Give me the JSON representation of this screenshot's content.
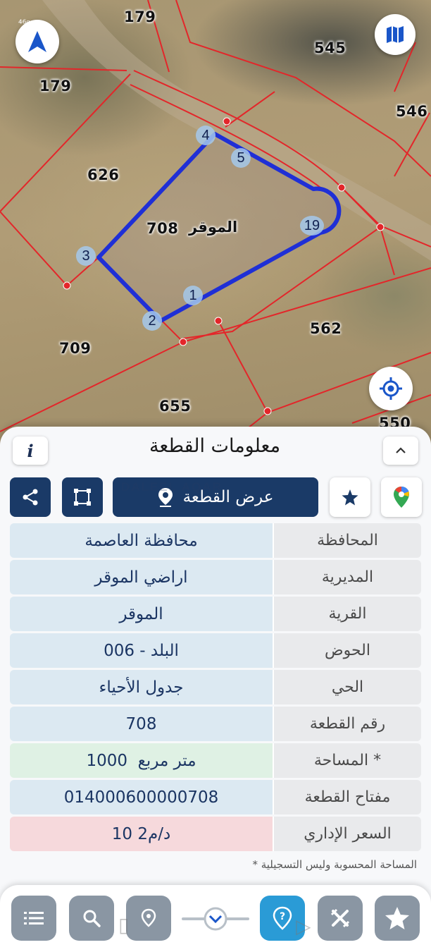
{
  "map": {
    "lot_numbers": {
      "lot_179_a": "179",
      "lot_179_b": "179",
      "lot_545": "545",
      "lot_546": "546",
      "lot_626": "626",
      "lot_708": "708",
      "lot_709": "709",
      "lot_562": "562",
      "lot_655": "655",
      "lot_550": "550"
    },
    "area_label": "الموقر",
    "vertices": [
      "4",
      "5",
      "19",
      "3",
      "1",
      "2"
    ],
    "parcel_line_color": "#e3262a",
    "highlight_color": "#1f2fd6",
    "status_bar": "⁴⁶ᵍ"
  },
  "panel": {
    "title": "معلومات القطعة",
    "info_icon": "i",
    "show_plot_label": "عرض القطعة",
    "watermark": "DALEEL AQAR",
    "rows": [
      {
        "label": "المحافظة",
        "value": "محافظة العاصمة"
      },
      {
        "label": "المديرية",
        "value": "اراضي الموقر"
      },
      {
        "label": "القرية",
        "value": "الموقر"
      },
      {
        "label": "الحوض",
        "value": "البلد - 006"
      },
      {
        "label": "الحي",
        "value": "جدول الأحياء"
      },
      {
        "label": "رقم القطعة",
        "value": "708"
      },
      {
        "label": "المساحة *",
        "value": "1000  متر مربع"
      },
      {
        "label": "مفتاح القطعة",
        "value": "014000600000708"
      },
      {
        "label": "السعر الإداري",
        "value": "10 د/م2"
      }
    ],
    "footnote": "* المساحة المحسوبة وليس التسجيلية"
  },
  "colors": {
    "navy": "#1a3a67",
    "nav_gray": "#8a96a3",
    "nav_primary": "#2a9bd6",
    "value_bg": "#dce9f2",
    "area_bg": "#dff1e4",
    "price_bg": "#f6d9dc"
  }
}
